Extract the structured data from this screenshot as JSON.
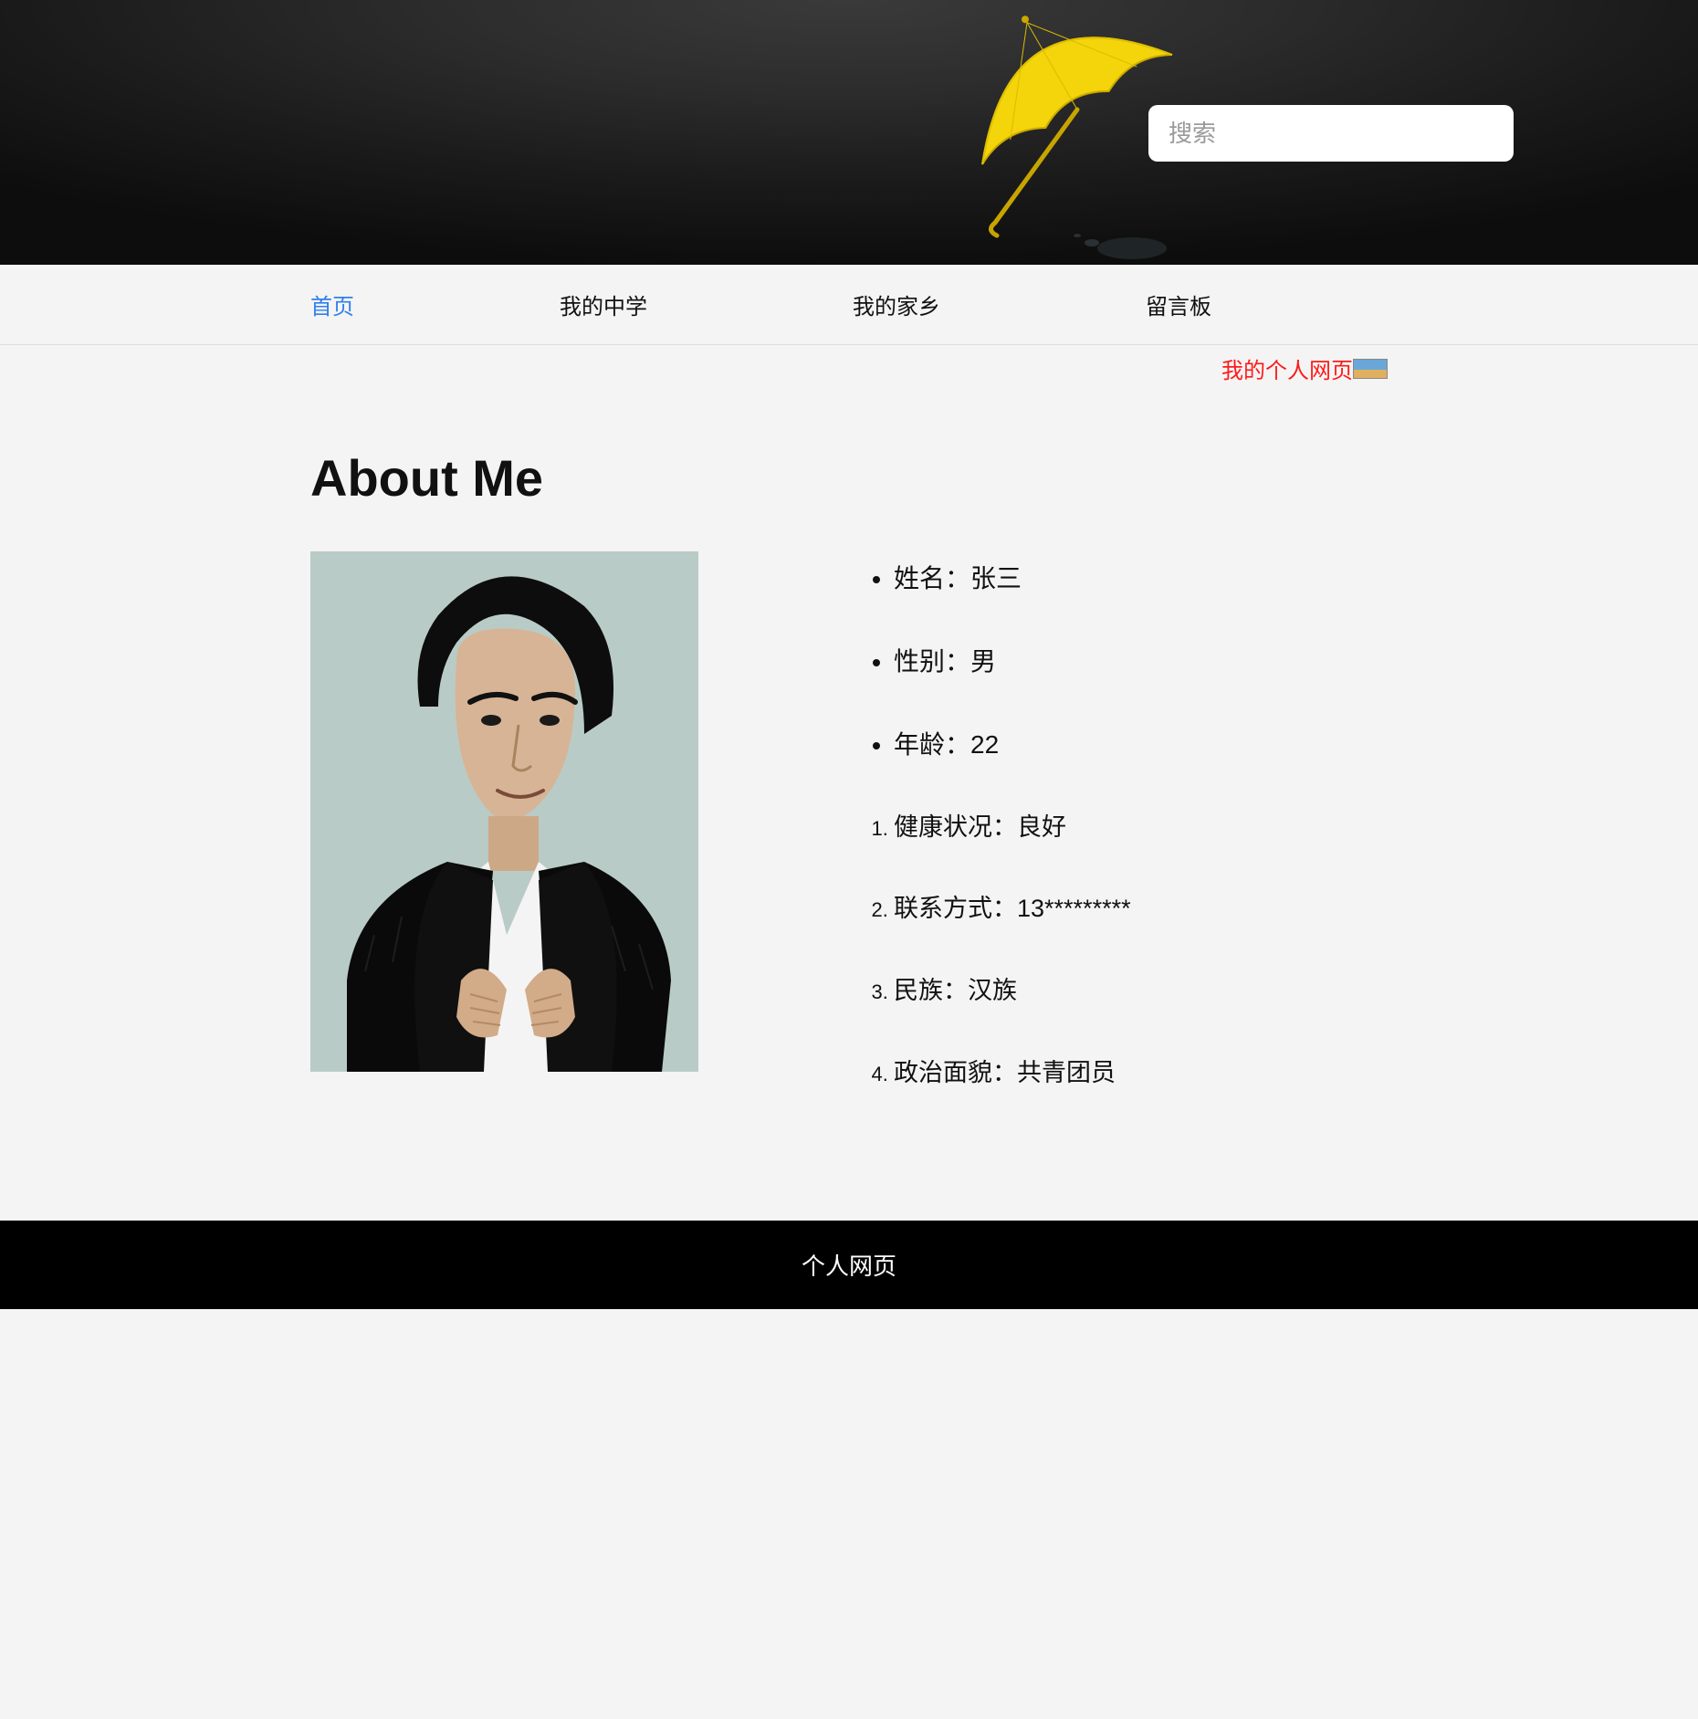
{
  "header": {
    "search_placeholder": "搜索"
  },
  "nav": {
    "items": [
      {
        "label": "首页",
        "active": true
      },
      {
        "label": "我的中学",
        "active": false
      },
      {
        "label": "我的家乡",
        "active": false
      },
      {
        "label": "留言板",
        "active": false
      }
    ]
  },
  "marquee": {
    "label": "我的个人网页"
  },
  "about": {
    "title": "About Me",
    "basic": [
      "姓名：张三",
      "性别：男",
      "年龄：22"
    ],
    "details": [
      "健康状况：良好",
      "联系方式：13*********",
      "民族：汉族",
      "政治面貌：共青团员"
    ]
  },
  "footer": {
    "text": "个人网页"
  }
}
